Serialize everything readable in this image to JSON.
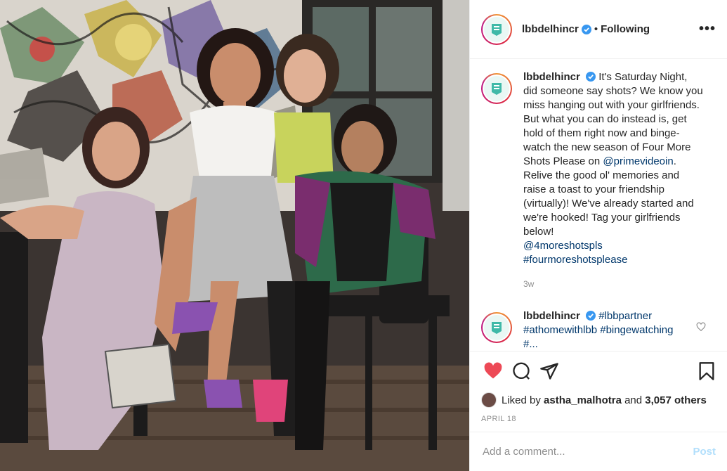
{
  "post": {
    "username": "lbbdelhincr",
    "follow_state": "Following",
    "more_label": "•••",
    "caption_user": "lbbdelhincr",
    "caption_part1": "It's Saturday Night, did someone say shots? We know you miss hanging out with your girlfriends. But what you can do instead is, get hold of them right now and binge-watch the new season of Four More Shots Please on ",
    "caption_mention": "@primevideoin",
    "caption_part2": ". Relive the good ol' memories and raise a toast to your friendship (virtually)! We've already started and we're hooked! Tag your girlfriends below!",
    "caption_mention2": "@4moreshotspls",
    "caption_hashtag": "#fourmoreshotsplease",
    "caption_age": "3w",
    "comment2_user": "lbbdelhincr",
    "comment2_line1": "#lbbpartner",
    "comment2_line2": "#athomewithlbb #bingewatching",
    "comment2_line3": "#..."
  },
  "likes": {
    "prefix": "Liked by",
    "user": "astha_malhotra",
    "and": "and",
    "others": "3,057 others"
  },
  "date": "APRIL 18",
  "comment_box": {
    "placeholder": "Add a comment...",
    "post_label": "Post"
  },
  "colors": {
    "verified": "#3897f0",
    "like_red": "#ed4956",
    "link": "#00376b",
    "post_disabled": "#b2dffc"
  },
  "icons": {
    "more": "more-icon",
    "heart": "heart-icon",
    "comment": "comment-icon",
    "share": "share-icon",
    "bookmark": "bookmark-icon"
  }
}
